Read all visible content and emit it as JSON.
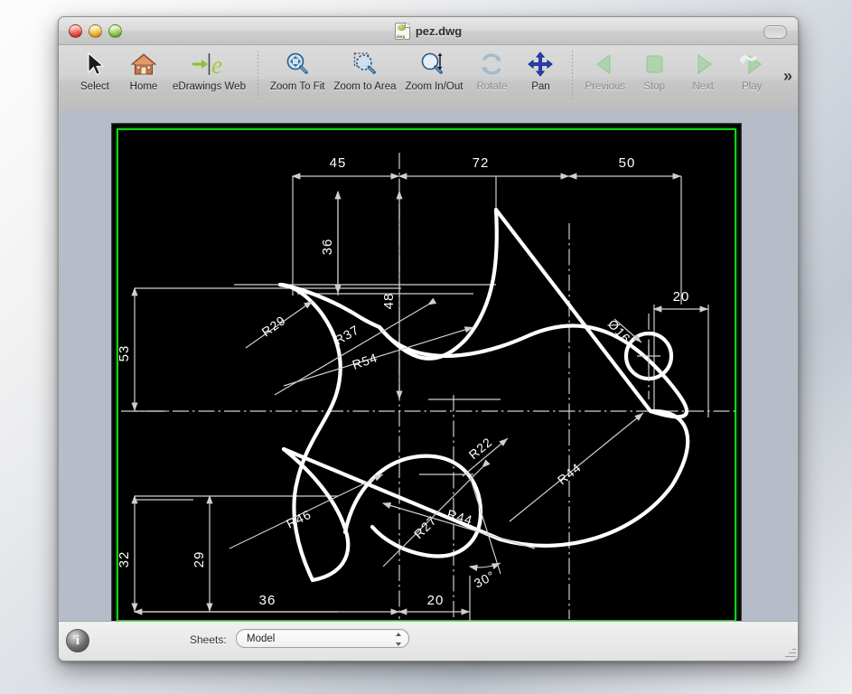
{
  "window": {
    "title": "pez.dwg",
    "title_icon": "dwg-file-icon",
    "traffic_lights": [
      "close-button",
      "minimize-button",
      "zoom-button"
    ],
    "toolbar_toggle": "toolbar-toggle-button"
  },
  "toolbar": {
    "overflow_label": "»",
    "groups": [
      {
        "items": [
          {
            "label": "Select",
            "icon": "cursor-arrow-icon",
            "enabled": true
          },
          {
            "label": "Home",
            "icon": "home-icon",
            "enabled": true
          },
          {
            "label": "eDrawings Web",
            "icon": "edrawings-web-icon",
            "enabled": true
          }
        ]
      },
      {
        "items": [
          {
            "label": "Zoom To Fit",
            "icon": "zoom-to-fit-icon",
            "enabled": true
          },
          {
            "label": "Zoom to Area",
            "icon": "zoom-to-area-icon",
            "enabled": true
          },
          {
            "label": "Zoom In/Out",
            "icon": "zoom-in-out-icon",
            "enabled": true
          },
          {
            "label": "Rotate",
            "icon": "rotate-icon",
            "enabled": false
          },
          {
            "label": "Pan",
            "icon": "pan-icon",
            "enabled": true
          }
        ]
      },
      {
        "items": [
          {
            "label": "Previous",
            "icon": "previous-icon",
            "enabled": false
          },
          {
            "label": "Stop",
            "icon": "stop-icon",
            "enabled": false
          },
          {
            "label": "Next",
            "icon": "next-icon",
            "enabled": false
          },
          {
            "label": "Play",
            "icon": "play-animation-icon",
            "enabled": false
          }
        ]
      }
    ]
  },
  "statusbar": {
    "info_button_glyph": "i",
    "sheets_label": "Sheets:",
    "sheet_selected": "Model",
    "sheet_options": [
      "Model"
    ],
    "resize_grip": "resize-grip"
  },
  "canvas": {
    "background": "#000000",
    "sheet_border_color": "#13d413",
    "geometry_color": "#ffffff",
    "drawing_name": "fish-technical-drawing"
  },
  "drawing_dimensions": {
    "linear_top": [
      "45",
      "72",
      "50"
    ],
    "vertical_upper": [
      "36",
      "48"
    ],
    "vertical_left": [
      "53",
      "32",
      "29"
    ],
    "right": [
      "20"
    ],
    "bottom": [
      "36",
      "20"
    ],
    "angular": [
      "30°"
    ],
    "radii": [
      "R29",
      "R37",
      "R54",
      "R46",
      "R44",
      "R22",
      "R27",
      "R44"
    ],
    "diameter": [
      "ø16"
    ],
    "all_labels": [
      "45",
      "72",
      "50",
      "36",
      "48",
      "53",
      "32",
      "29",
      "20",
      "36",
      "20",
      "30°",
      "R29",
      "R37",
      "R54",
      "R46",
      "R44",
      "R22",
      "R27",
      "R44",
      "ø16"
    ]
  }
}
